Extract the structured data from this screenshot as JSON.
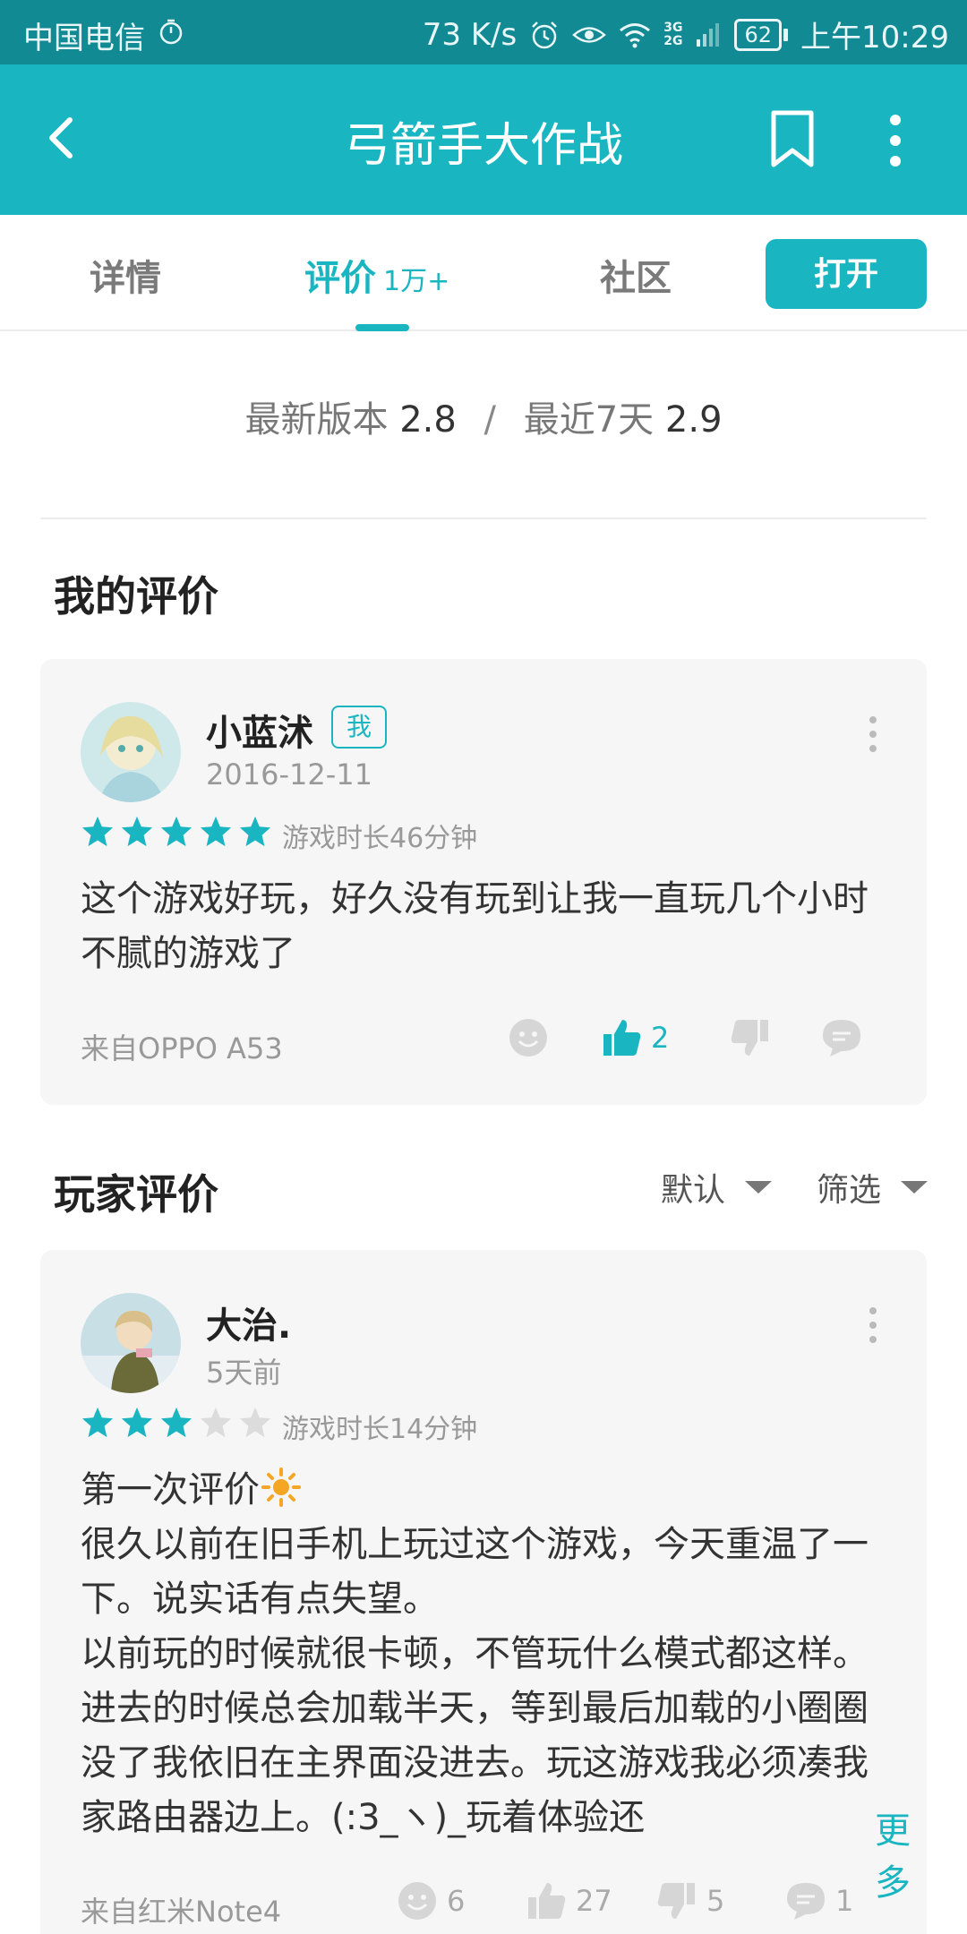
{
  "status_bar": {
    "carrier": "中国电信",
    "speed": "73 K/s",
    "network_top": "3G",
    "network_bottom": "2G",
    "battery": "62",
    "time": "上午10:29"
  },
  "app_bar": {
    "title": "弓箭手大作战"
  },
  "tabs": {
    "detail": "详情",
    "review": "评价",
    "review_count": "1万+",
    "community": "社区",
    "open_button": "打开"
  },
  "ratings": {
    "latest_label": "最新版本",
    "latest_value": "2.8",
    "separator": "/",
    "recent_label": "最近7天",
    "recent_value": "2.9"
  },
  "my_review": {
    "section_title": "我的评价",
    "username": "小蓝沭",
    "badge": "我",
    "date": "2016-12-11",
    "stars": 5,
    "playtime": "游戏时长46分钟",
    "text": "这个游戏好玩，好久没有玩到让我一直玩几个小时不腻的游戏了",
    "device": "来自OPPO A53",
    "likes": "2"
  },
  "player_reviews": {
    "section_title": "玩家评价",
    "sort_label": "默认",
    "filter_label": "筛选",
    "items": [
      {
        "username": "大治.",
        "date": "5天前",
        "stars": 3,
        "playtime": "游戏时长14分钟",
        "line1": "第一次评价",
        "text": "很久以前在旧手机上玩过这个游戏，今天重温了一下。说实话有点失望。",
        "text2": "以前玩的时候就很卡顿，不管玩什么模式都这样。进去的时候总会加载半天，等到最后加载的小圈圈没了我依旧在主界面没进去。玩这游戏我必须凑我家路由器边上。(:3_ヽ)_玩着体验还",
        "more": "更多",
        "device": "来自红米Note4",
        "smile_count": "6",
        "like_count": "27",
        "dislike_count": "5",
        "comment_count": "1"
      }
    ]
  },
  "colors": {
    "accent": "#19b6c2",
    "status_bar": "#128a93",
    "card_bg": "#f6f6f6"
  }
}
